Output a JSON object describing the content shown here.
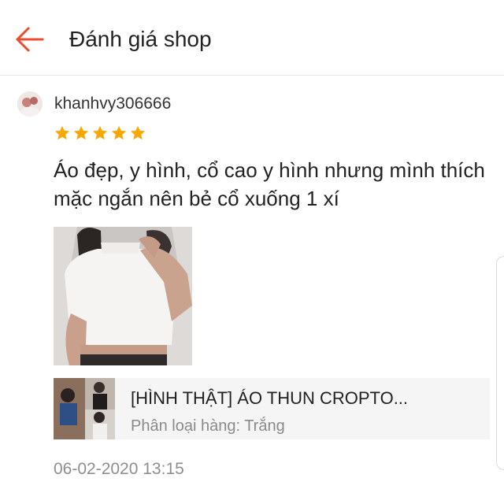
{
  "header": {
    "title": "Đánh giá shop",
    "back_icon": "arrow-left-icon",
    "accent_color": "#ee4d2d"
  },
  "review": {
    "username": "khanhvy306666",
    "rating": 5,
    "rating_max": 5,
    "star_color": "#f6a700",
    "text": "Áo đẹp, y hình, cổ cao y hình nhưng mình thích mặc ngắn nên bẻ cổ xuống 1 xí",
    "date": "06-02-2020 13:15"
  },
  "product": {
    "name": "[HÌNH THẬT] ÁO THUN CROPTO...",
    "variant": "Phân loại hàng: Trắng"
  }
}
